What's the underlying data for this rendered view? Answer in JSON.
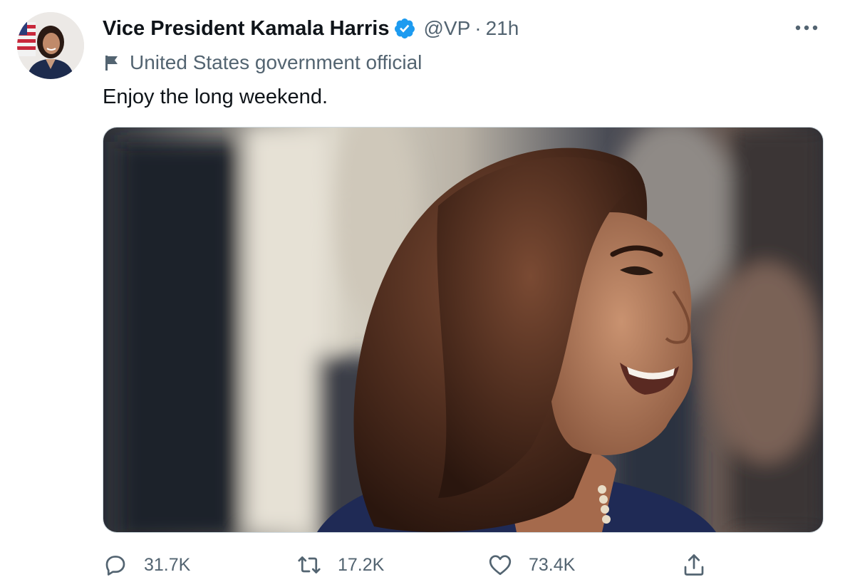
{
  "tweet": {
    "display_name": "Vice President Kamala Harris",
    "handle": "@VP",
    "separator": "·",
    "time": "21h",
    "account_label": "United States government official",
    "text": "Enjoy the long weekend.",
    "verified_icon": "verified-badge-icon",
    "more_icon": "more-options-icon"
  },
  "actions": {
    "reply": {
      "icon": "reply-icon",
      "count": "31.7K"
    },
    "retweet": {
      "icon": "retweet-icon",
      "count": "17.2K"
    },
    "like": {
      "icon": "heart-icon",
      "count": "73.4K"
    },
    "share": {
      "icon": "share-icon"
    }
  },
  "colors": {
    "text_primary": "#0f1419",
    "text_secondary": "#536471",
    "verified_blue": "#1d9bf0",
    "border": "#cfd9de"
  }
}
